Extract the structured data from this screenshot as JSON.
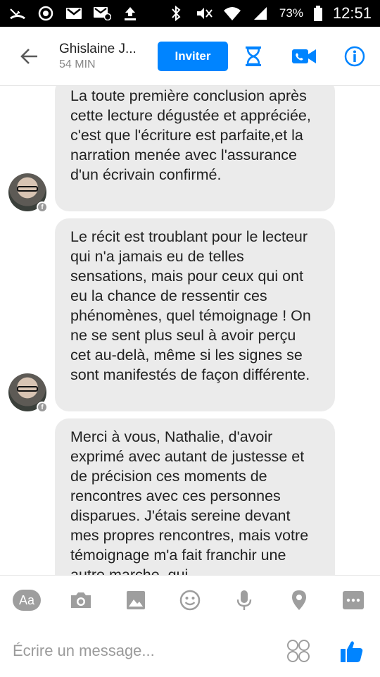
{
  "statusbar": {
    "battery": "73%",
    "time": "12:51",
    "left_icons": [
      "missed-call-icon",
      "sync-icon",
      "gmail-icon",
      "gmail-at-icon",
      "upload-icon"
    ],
    "right_icons": [
      "bluetooth-icon",
      "mute-icon",
      "wifi-icon",
      "signal-icon",
      "battery-icon"
    ]
  },
  "header": {
    "contact_name": "Ghislaine J...",
    "contact_status": "54 MIN",
    "invite_label": "Inviter",
    "icons": [
      "back-arrow-icon",
      "hourglass-icon",
      "video-call-icon",
      "info-icon"
    ],
    "accent": "#0084ff"
  },
  "messages": [
    {
      "text": "La toute première conclusion après cette lecture dégustée et appréciée, c'est que l'écriture est parfaite,et  la narration menée avec l'assurance d'un écrivain confirmé."
    },
    {
      "text": "Le récit est troublant pour le lecteur qui n'a jamais eu de telles sensations, mais pour ceux qui ont eu la chance de ressentir ces phénomènes, quel témoignage ! On ne se sent plus seul à avoir perçu cet au-delà, même si les signes se sont manifestés de façon différente."
    },
    {
      "text": "Merci à vous, Nathalie, d'avoir exprimé avec autant de justesse et de précision ces moments de rencontres avec ces personnes disparues. J'étais sereine devant mes propres rencontres, mais votre témoignage m'a fait franchir une autre marche, qui"
    }
  ],
  "composer": {
    "aa_label": "Aa",
    "placeholder": "Écrire un message...",
    "tools": [
      "camera-icon",
      "image-icon",
      "emoji-icon",
      "microphone-icon",
      "location-icon",
      "more-icon"
    ]
  }
}
